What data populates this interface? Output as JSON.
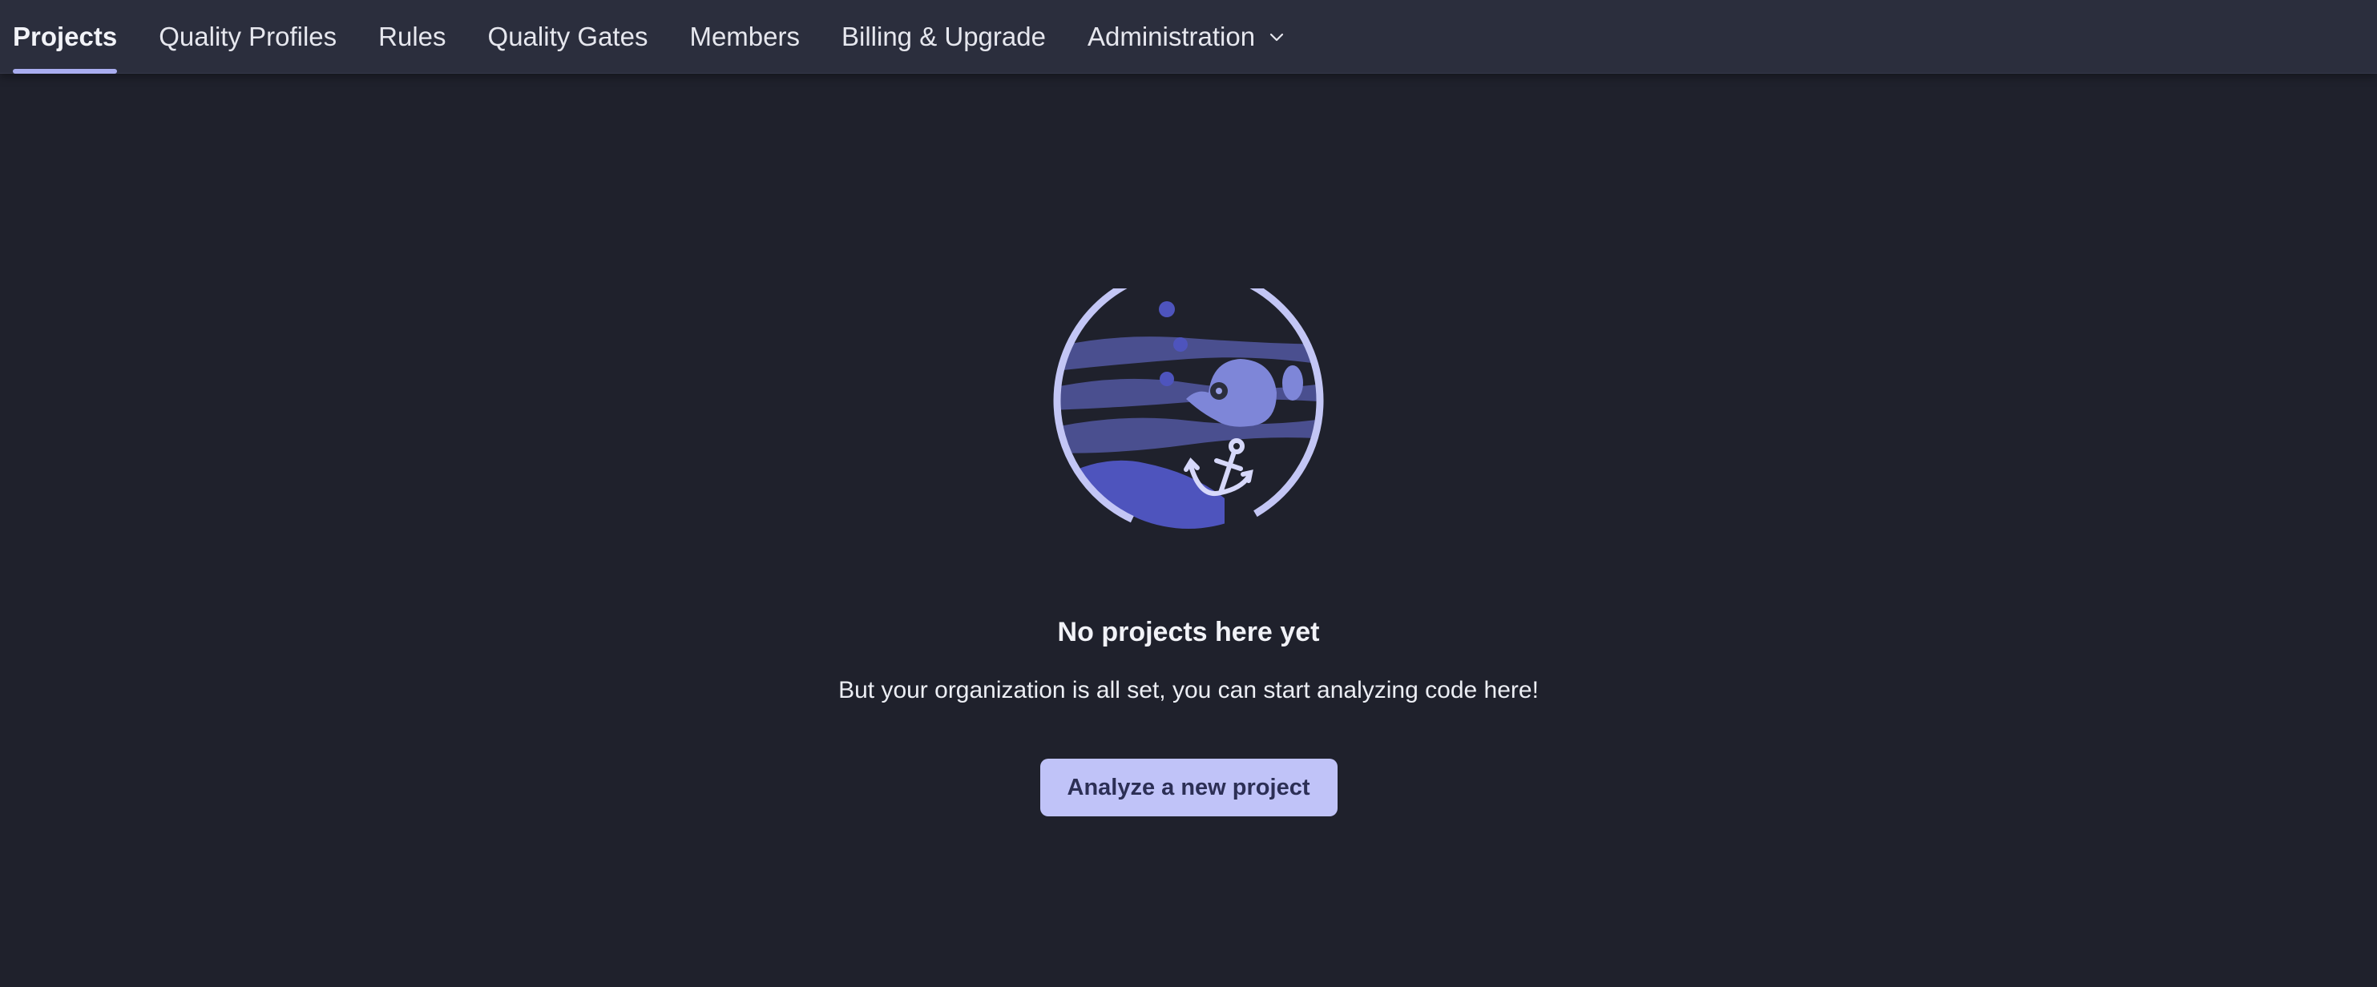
{
  "nav": {
    "items": [
      {
        "label": "Projects",
        "active": true
      },
      {
        "label": "Quality Profiles",
        "active": false
      },
      {
        "label": "Rules",
        "active": false
      },
      {
        "label": "Quality Gates",
        "active": false
      },
      {
        "label": "Members",
        "active": false
      },
      {
        "label": "Billing & Upgrade",
        "active": false
      },
      {
        "label": "Administration",
        "active": false,
        "icon": "chevron-down-icon"
      }
    ]
  },
  "empty_state": {
    "illustration_icon": "fishbowl-anchor-icon",
    "title": "No projects here yet",
    "description": "But your organization is all set, you can start analyzing code here!",
    "cta_label": "Analyze a new project"
  },
  "colors": {
    "background": "#1f212c",
    "nav_background": "#2b2e3d",
    "accent": "#a9adf0",
    "button": "#c0c3f8",
    "button_text": "#2c2f55"
  }
}
